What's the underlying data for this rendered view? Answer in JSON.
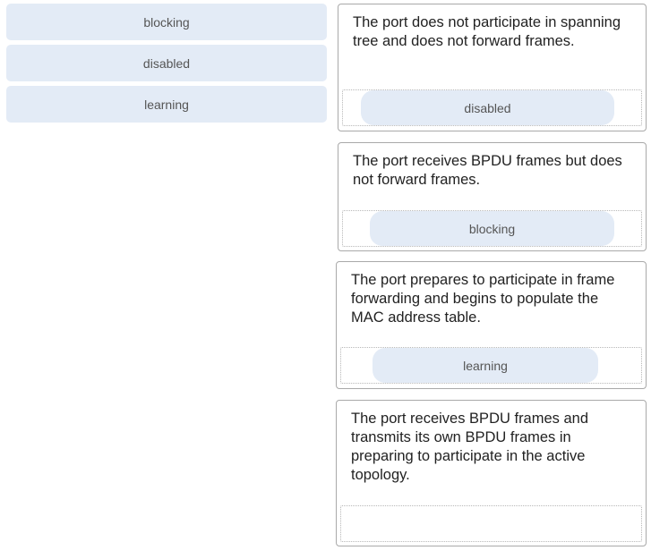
{
  "options": [
    {
      "label": "blocking"
    },
    {
      "label": "disabled"
    },
    {
      "label": "learning"
    }
  ],
  "targets": [
    {
      "description": "The port does not participate in spanning tree and does not forward frames.",
      "answer": "disabled"
    },
    {
      "description": "The port receives BPDU frames but does not forward frames.",
      "answer": "blocking"
    },
    {
      "description": "The port prepares to participate in frame forwarding and begins to populate the MAC address table.",
      "answer": "learning"
    },
    {
      "description": "The port receives BPDU frames and transmits its own BPDU frames in preparing to participate in the active topology.",
      "answer": ""
    }
  ]
}
